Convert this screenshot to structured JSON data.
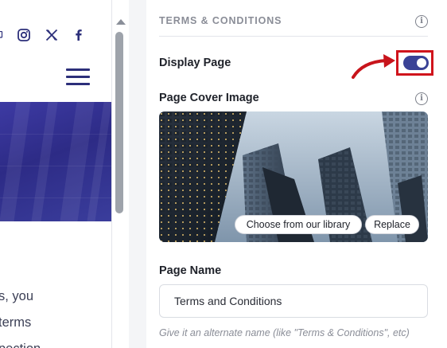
{
  "panel": {
    "section_title": "TERMS & CONDITIONS",
    "display_page_label": "Display Page",
    "display_page_enabled": true,
    "cover_image_label": "Page Cover Image",
    "choose_library_label": "Choose from our library",
    "replace_label": "Replace",
    "page_name_label": "Page Name",
    "page_name_value": "Terms and Conditions",
    "helper_text": "Give it an alternate name (like \"Terms & Conditions\", etc)"
  },
  "preview": {
    "social_icons": [
      "instagram-icon",
      "x-icon",
      "facebook-icon"
    ],
    "text_lines": [
      "s, you",
      "terms",
      "pection"
    ]
  },
  "colors": {
    "accent": "#3a4296",
    "highlight": "#d0141c",
    "hero": "#2d2b86"
  },
  "icons": {
    "menu": "hamburger-icon",
    "info": "info-icon",
    "annotation_arrow": "red-arrow-icon"
  }
}
